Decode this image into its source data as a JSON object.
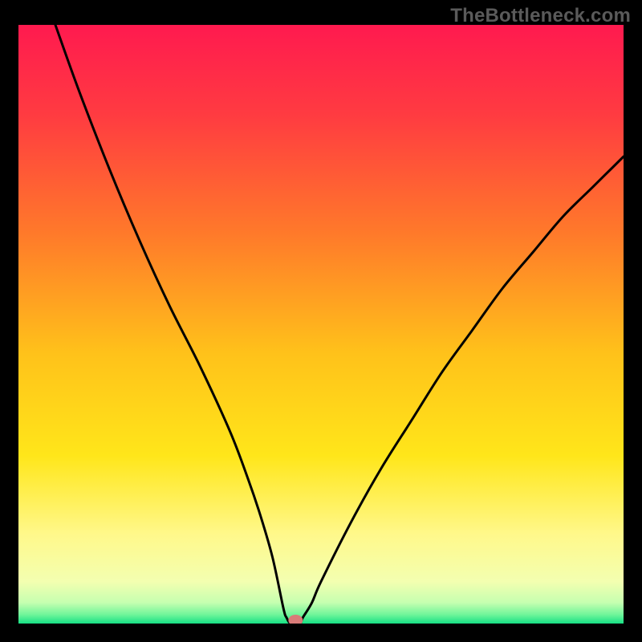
{
  "watermark": "TheBottleneck.com",
  "chart_data": {
    "type": "line",
    "title": "",
    "xlabel": "",
    "ylabel": "",
    "xlim": [
      0,
      100
    ],
    "ylim": [
      0,
      100
    ],
    "series": [
      {
        "name": "curve",
        "x": [
          6.1,
          10,
          15,
          20,
          25,
          30,
          35,
          38,
          40,
          42,
          43.8,
          44.3,
          45.0,
          46.5,
          47.0,
          48.5,
          50,
          55,
          60,
          65,
          70,
          75,
          80,
          85,
          90,
          95,
          100
        ],
        "values": [
          100,
          89,
          76,
          64,
          53,
          43,
          32,
          24,
          18,
          11,
          2.5,
          1.0,
          0.0,
          0.0,
          1.0,
          3.5,
          7,
          17,
          26,
          34,
          42,
          49,
          56,
          62,
          68,
          73,
          78
        ]
      }
    ],
    "marker": {
      "x": 45.8,
      "y": 0.0
    },
    "gradient_stops": [
      {
        "offset": 0.0,
        "color": "#ff1a4f"
      },
      {
        "offset": 0.15,
        "color": "#ff3b41"
      },
      {
        "offset": 0.35,
        "color": "#ff7a2a"
      },
      {
        "offset": 0.55,
        "color": "#ffc21a"
      },
      {
        "offset": 0.72,
        "color": "#ffe61a"
      },
      {
        "offset": 0.85,
        "color": "#fff88a"
      },
      {
        "offset": 0.93,
        "color": "#f3ffb0"
      },
      {
        "offset": 0.965,
        "color": "#c6ffb0"
      },
      {
        "offset": 0.985,
        "color": "#70f59a"
      },
      {
        "offset": 1.0,
        "color": "#17e084"
      }
    ]
  }
}
